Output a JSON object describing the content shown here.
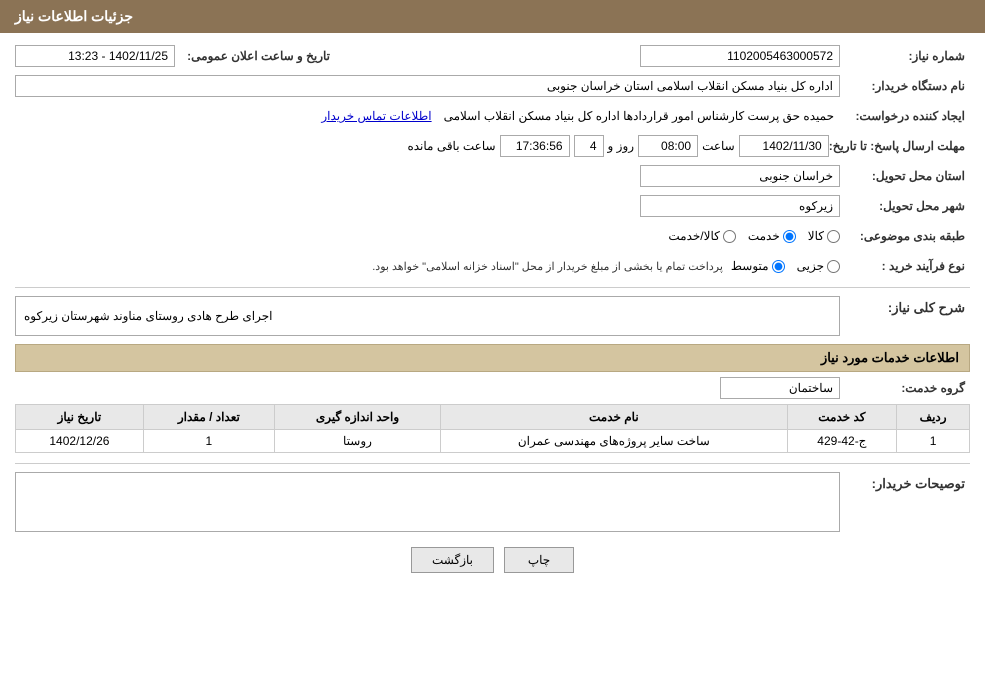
{
  "header": {
    "title": "جزئیات اطلاعات نیاز"
  },
  "info": {
    "shomara_niaz_label": "شماره نیاز:",
    "shomara_niaz_value": "1102005463000572",
    "nam_dastgah_label": "نام دستگاه خریدار:",
    "nam_dastgah_value": "اداره کل بنیاد مسکن انقلاب اسلامی استان خراسان جنوبی",
    "ijad_label": "ایجاد کننده درخواست:",
    "ijad_value": "حمیده حق پرست کارشناس امور قراردادها اداره کل بنیاد مسکن انقلاب اسلامی",
    "ijad_link": "اطلاعات تماس خریدار",
    "mohlat_label": "مهلت ارسال پاسخ: تا تاریخ:",
    "tarikh_label": "تاریخ و ساعت اعلان عمومی:",
    "tarikh_value": "1402/11/25 - 13:23",
    "mohlat_date": "1402/11/30",
    "mohlat_saat": "08:00",
    "mohlat_rooz": "4",
    "mohlat_countdown": "17:36:56",
    "mohlat_baqi": "ساعت باقی مانده",
    "ostan_label": "استان محل تحویل:",
    "ostan_value": "خراسان جنوبی",
    "shahr_label": "شهر محل تحویل:",
    "shahr_value": "زیرکوه",
    "tabaqe_label": "طبقه بندی موضوعی:",
    "tabaqe_kala": "کالا",
    "tabaqe_khedmat": "خدمت",
    "tabaqe_kala_khedmat": "کالا/خدمت",
    "tabaqe_selected": "khedmat",
    "noe_farayand_label": "نوع فرآیند خرید :",
    "noe_jozvi": "جزیی",
    "noe_motavaset": "متوسط",
    "noe_selected": "motavaset",
    "noe_note": "پرداخت تمام یا بخشی از مبلغ خریدار از محل \"اسناد خزانه اسلامی\" خواهد بود.",
    "sherh_label": "شرح کلی نیاز:",
    "sherh_value": "اجرای طرح هادی روستای مناوند شهرستان زیرکوه"
  },
  "services_section": {
    "title": "اطلاعات خدمات مورد نیاز",
    "group_label": "گروه خدمت:",
    "group_value": "ساختمان",
    "table": {
      "headers": [
        "ردیف",
        "کد خدمت",
        "نام خدمت",
        "واحد اندازه گیری",
        "تعداد / مقدار",
        "تاریخ نیاز"
      ],
      "rows": [
        {
          "radif": "1",
          "code": "ج-42-429",
          "name": "ساخت سایر پروژه‌های مهندسی عمران",
          "unit": "روستا",
          "count": "1",
          "date": "1402/12/26"
        }
      ]
    }
  },
  "buyer_desc": {
    "label": "توصیحات خریدار:",
    "value": ""
  },
  "buttons": {
    "chap": "چاپ",
    "bazgasht": "بازگشت"
  }
}
